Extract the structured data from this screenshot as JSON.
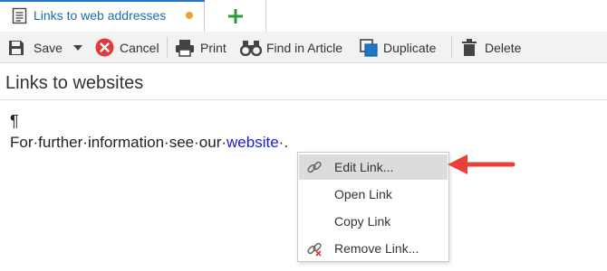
{
  "tab": {
    "title": "Links to web addresses",
    "icon": "document-icon",
    "modified_color": "#f0a030"
  },
  "add_tab": {
    "icon": "plus-icon",
    "color": "#2e9a3c"
  },
  "toolbar": {
    "save_label": "Save",
    "cancel_label": "Cancel",
    "print_label": "Print",
    "find_label": "Find in Article",
    "duplicate_label": "Duplicate",
    "delete_label": "Delete"
  },
  "article": {
    "heading": "Links to websites",
    "pilcrow": "¶",
    "sentence_before": "For·further·information·see·our·",
    "link_text": "website",
    "sentence_after": "·.",
    "link_color": "#1a1ad6"
  },
  "context_menu": {
    "items": [
      {
        "label": "Edit Link...",
        "icon": "link-icon",
        "highlighted": true
      },
      {
        "label": "Open Link",
        "icon": "",
        "highlighted": false
      },
      {
        "label": "Copy Link",
        "icon": "",
        "highlighted": false
      },
      {
        "label": "Remove Link...",
        "icon": "unlink-icon",
        "highlighted": false
      }
    ]
  },
  "annotation": {
    "icon": "red-arrow-icon",
    "color": "#e8413a"
  }
}
